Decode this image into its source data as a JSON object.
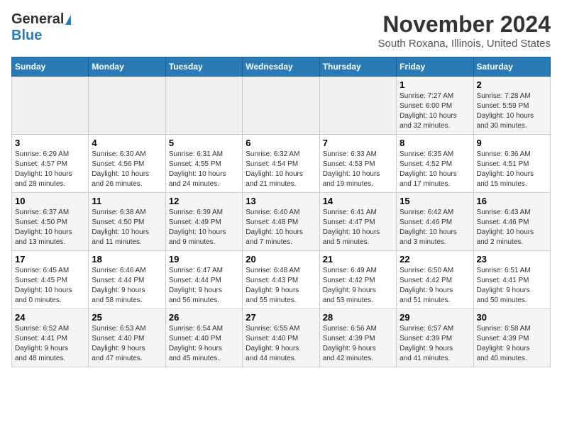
{
  "logo": {
    "line1": "General",
    "line2": "Blue"
  },
  "title": "November 2024",
  "subtitle": "South Roxana, Illinois, United States",
  "weekdays": [
    "Sunday",
    "Monday",
    "Tuesday",
    "Wednesday",
    "Thursday",
    "Friday",
    "Saturday"
  ],
  "weeks": [
    [
      {
        "day": "",
        "info": ""
      },
      {
        "day": "",
        "info": ""
      },
      {
        "day": "",
        "info": ""
      },
      {
        "day": "",
        "info": ""
      },
      {
        "day": "",
        "info": ""
      },
      {
        "day": "1",
        "info": "Sunrise: 7:27 AM\nSunset: 6:00 PM\nDaylight: 10 hours\nand 32 minutes."
      },
      {
        "day": "2",
        "info": "Sunrise: 7:28 AM\nSunset: 5:59 PM\nDaylight: 10 hours\nand 30 minutes."
      }
    ],
    [
      {
        "day": "3",
        "info": "Sunrise: 6:29 AM\nSunset: 4:57 PM\nDaylight: 10 hours\nand 28 minutes."
      },
      {
        "day": "4",
        "info": "Sunrise: 6:30 AM\nSunset: 4:56 PM\nDaylight: 10 hours\nand 26 minutes."
      },
      {
        "day": "5",
        "info": "Sunrise: 6:31 AM\nSunset: 4:55 PM\nDaylight: 10 hours\nand 24 minutes."
      },
      {
        "day": "6",
        "info": "Sunrise: 6:32 AM\nSunset: 4:54 PM\nDaylight: 10 hours\nand 21 minutes."
      },
      {
        "day": "7",
        "info": "Sunrise: 6:33 AM\nSunset: 4:53 PM\nDaylight: 10 hours\nand 19 minutes."
      },
      {
        "day": "8",
        "info": "Sunrise: 6:35 AM\nSunset: 4:52 PM\nDaylight: 10 hours\nand 17 minutes."
      },
      {
        "day": "9",
        "info": "Sunrise: 6:36 AM\nSunset: 4:51 PM\nDaylight: 10 hours\nand 15 minutes."
      }
    ],
    [
      {
        "day": "10",
        "info": "Sunrise: 6:37 AM\nSunset: 4:50 PM\nDaylight: 10 hours\nand 13 minutes."
      },
      {
        "day": "11",
        "info": "Sunrise: 6:38 AM\nSunset: 4:50 PM\nDaylight: 10 hours\nand 11 minutes."
      },
      {
        "day": "12",
        "info": "Sunrise: 6:39 AM\nSunset: 4:49 PM\nDaylight: 10 hours\nand 9 minutes."
      },
      {
        "day": "13",
        "info": "Sunrise: 6:40 AM\nSunset: 4:48 PM\nDaylight: 10 hours\nand 7 minutes."
      },
      {
        "day": "14",
        "info": "Sunrise: 6:41 AM\nSunset: 4:47 PM\nDaylight: 10 hours\nand 5 minutes."
      },
      {
        "day": "15",
        "info": "Sunrise: 6:42 AM\nSunset: 4:46 PM\nDaylight: 10 hours\nand 3 minutes."
      },
      {
        "day": "16",
        "info": "Sunrise: 6:43 AM\nSunset: 4:46 PM\nDaylight: 10 hours\nand 2 minutes."
      }
    ],
    [
      {
        "day": "17",
        "info": "Sunrise: 6:45 AM\nSunset: 4:45 PM\nDaylight: 10 hours\nand 0 minutes."
      },
      {
        "day": "18",
        "info": "Sunrise: 6:46 AM\nSunset: 4:44 PM\nDaylight: 9 hours\nand 58 minutes."
      },
      {
        "day": "19",
        "info": "Sunrise: 6:47 AM\nSunset: 4:44 PM\nDaylight: 9 hours\nand 56 minutes."
      },
      {
        "day": "20",
        "info": "Sunrise: 6:48 AM\nSunset: 4:43 PM\nDaylight: 9 hours\nand 55 minutes."
      },
      {
        "day": "21",
        "info": "Sunrise: 6:49 AM\nSunset: 4:42 PM\nDaylight: 9 hours\nand 53 minutes."
      },
      {
        "day": "22",
        "info": "Sunrise: 6:50 AM\nSunset: 4:42 PM\nDaylight: 9 hours\nand 51 minutes."
      },
      {
        "day": "23",
        "info": "Sunrise: 6:51 AM\nSunset: 4:41 PM\nDaylight: 9 hours\nand 50 minutes."
      }
    ],
    [
      {
        "day": "24",
        "info": "Sunrise: 6:52 AM\nSunset: 4:41 PM\nDaylight: 9 hours\nand 48 minutes."
      },
      {
        "day": "25",
        "info": "Sunrise: 6:53 AM\nSunset: 4:40 PM\nDaylight: 9 hours\nand 47 minutes."
      },
      {
        "day": "26",
        "info": "Sunrise: 6:54 AM\nSunset: 4:40 PM\nDaylight: 9 hours\nand 45 minutes."
      },
      {
        "day": "27",
        "info": "Sunrise: 6:55 AM\nSunset: 4:40 PM\nDaylight: 9 hours\nand 44 minutes."
      },
      {
        "day": "28",
        "info": "Sunrise: 6:56 AM\nSunset: 4:39 PM\nDaylight: 9 hours\nand 42 minutes."
      },
      {
        "day": "29",
        "info": "Sunrise: 6:57 AM\nSunset: 4:39 PM\nDaylight: 9 hours\nand 41 minutes."
      },
      {
        "day": "30",
        "info": "Sunrise: 6:58 AM\nSunset: 4:39 PM\nDaylight: 9 hours\nand 40 minutes."
      }
    ]
  ]
}
